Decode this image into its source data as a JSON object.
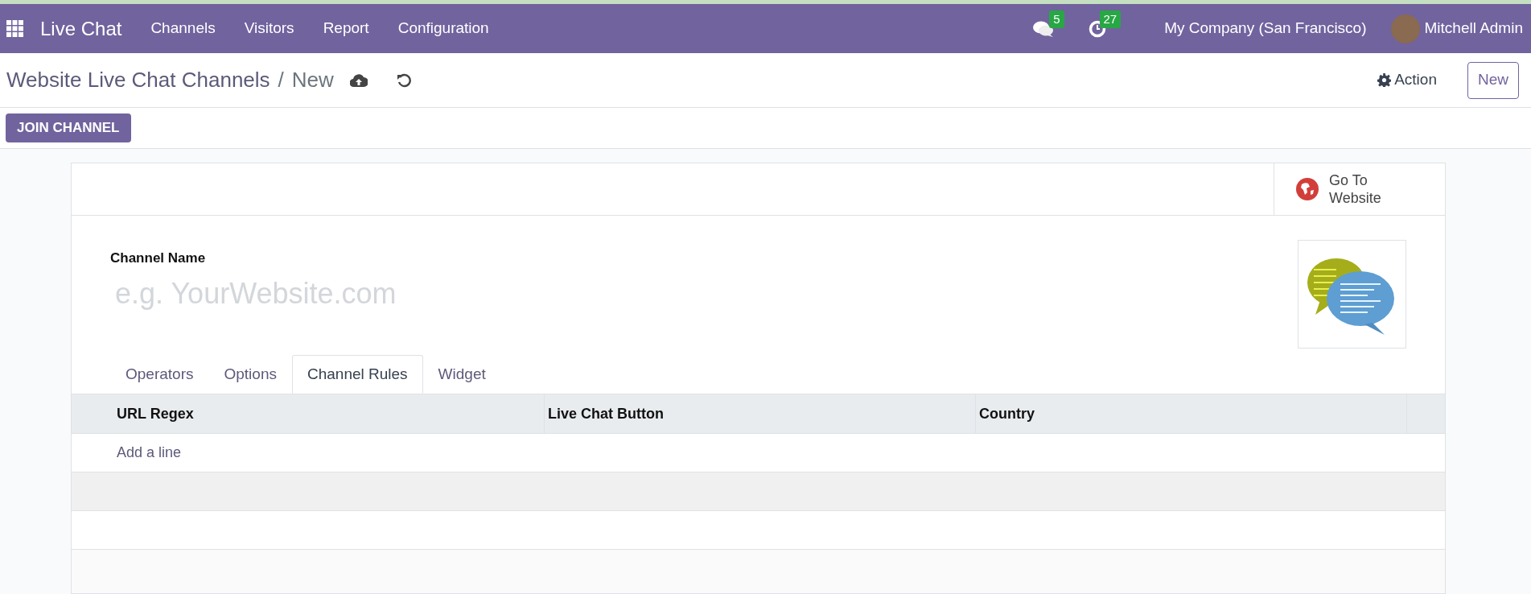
{
  "navbar": {
    "app_name": "Live Chat",
    "menu": [
      "Channels",
      "Visitors",
      "Report",
      "Configuration"
    ],
    "messages_badge": "5",
    "activities_badge": "27",
    "company": "My Company (San Francisco)",
    "user": "Mitchell Admin"
  },
  "breadcrumb": {
    "parent": "Website Live Chat Channels",
    "separator": "/",
    "current": "New"
  },
  "action_button": "Action",
  "new_button": "New",
  "status_buttons": [
    "JOIN CHANNEL"
  ],
  "smart_button": {
    "line_1": "Go To",
    "line_2": "Website"
  },
  "form": {
    "field_label": "Channel Name",
    "placeholder": "e.g. YourWebsite.com"
  },
  "tabs": [
    {
      "label": "Operators",
      "selected": false
    },
    {
      "label": "Options",
      "selected": false
    },
    {
      "label": "Channel Rules",
      "selected": true
    },
    {
      "label": "Widget",
      "selected": false
    }
  ],
  "table": {
    "columns": [
      "URL Regex",
      "Live Chat Button",
      "Country"
    ],
    "add_line": "Add a line"
  }
}
